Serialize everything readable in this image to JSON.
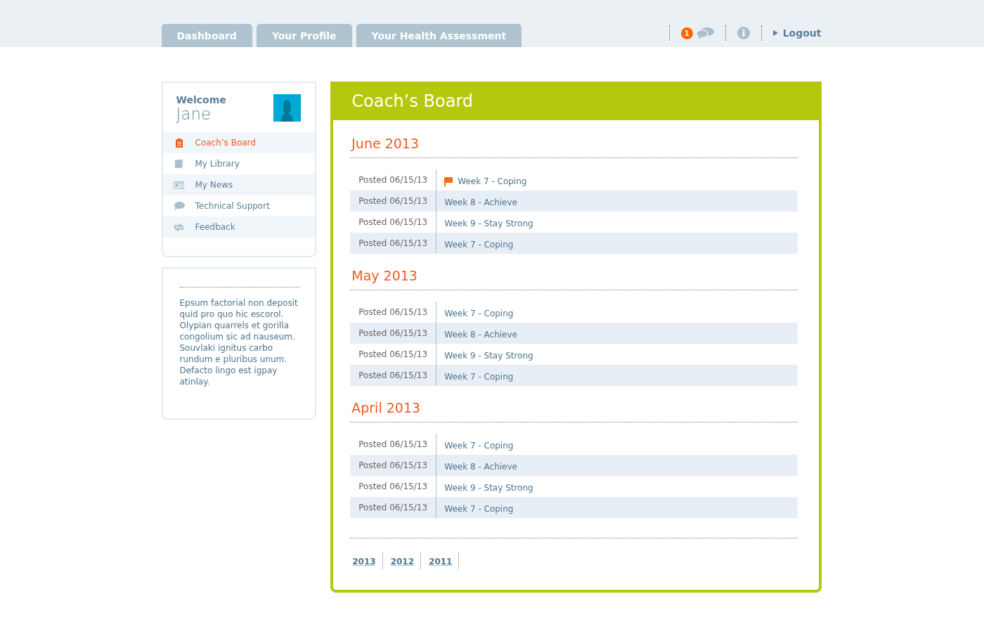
{
  "tabs": [
    {
      "label": "Dashboard",
      "selected": false
    },
    {
      "label": "Your Profile",
      "selected": false
    },
    {
      "label": "Your Health Assessment",
      "selected": false
    }
  ],
  "header": {
    "notification_count": "1",
    "logout": "Logout"
  },
  "sidebar": {
    "welcome": "Welcome",
    "name": "Jane",
    "items": [
      {
        "label": "Coach’s Board",
        "kind": "clipboard",
        "selected": true
      },
      {
        "label": "My Library",
        "kind": "book",
        "selected": false
      },
      {
        "label": "My News",
        "kind": "news",
        "selected": false
      },
      {
        "label": "Technical Support",
        "kind": "chat",
        "selected": false
      },
      {
        "label": "Feedback",
        "kind": "repeat",
        "selected": false
      }
    ]
  },
  "note": "Epsum factorial non deposit quid pro quo hic escorol. Olypian quarrels et gorilla congolium sic ad nauseum. Souvlaki ignitus carbo rundum e pluribus unum. Defacto lingo est igpay atinlay.",
  "board": {
    "title": "Coach’s Board",
    "months": [
      {
        "title": "June 2013",
        "posts": [
          {
            "date": "Posted 06/15/13",
            "link": "Week 7 - Coping",
            "flagged": true
          },
          {
            "date": "Posted 06/15/13",
            "link": "Week 8 - Achieve",
            "flagged": false
          },
          {
            "date": "Posted 06/15/13",
            "link": "Week 9 - Stay Strong",
            "flagged": false
          },
          {
            "date": "Posted 06/15/13",
            "link": "Week 7 - Coping",
            "flagged": false
          }
        ]
      },
      {
        "title": "May 2013",
        "posts": [
          {
            "date": "Posted 06/15/13",
            "link": "Week 7 - Coping",
            "flagged": false
          },
          {
            "date": "Posted 06/15/13",
            "link": "Week 8 - Achieve",
            "flagged": false
          },
          {
            "date": "Posted 06/15/13",
            "link": "Week 9 - Stay Strong",
            "flagged": false
          },
          {
            "date": "Posted 06/15/13",
            "link": "Week 7 - Coping",
            "flagged": false
          }
        ]
      },
      {
        "title": "April 2013",
        "posts": [
          {
            "date": "Posted 06/15/13",
            "link": "Week 7 - Coping",
            "flagged": false
          },
          {
            "date": "Posted 06/15/13",
            "link": "Week 8 - Achieve",
            "flagged": false
          },
          {
            "date": "Posted 06/15/13",
            "link": "Week 9 - Stay Strong",
            "flagged": false
          },
          {
            "date": "Posted 06/15/13",
            "link": "Week 7 - Coping",
            "flagged": false
          }
        ]
      }
    ],
    "years": [
      "2013",
      "2012",
      "2011"
    ]
  }
}
